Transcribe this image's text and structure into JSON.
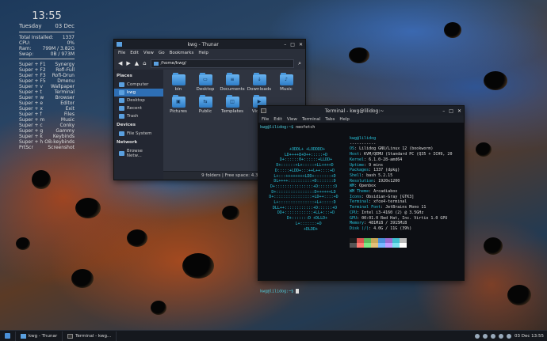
{
  "conky": {
    "time": "13:55",
    "day": "Tuesday",
    "date": "03 Dec",
    "stats": [
      [
        "Total Installed:",
        "1337"
      ],
      [
        "CPU:",
        "0%"
      ],
      [
        "Ram:",
        "799M / 3.82G"
      ],
      [
        "Swap:",
        "0B / 973M"
      ]
    ],
    "keys": [
      [
        "Super + F1",
        "Synergy"
      ],
      [
        "Super + F2",
        "Rofi-Full"
      ],
      [
        "Super + F3",
        "Rofi-Drun"
      ],
      [
        "Super + F5",
        "Dmenu"
      ],
      [
        "Super + v",
        "Wallpaper"
      ],
      [
        "Super + t",
        "Terminal"
      ],
      [
        "Super + w",
        "Browser"
      ],
      [
        "Super + e",
        "Editor"
      ],
      [
        "Super + x",
        "Exit"
      ],
      [
        "Super + f",
        "Files"
      ],
      [
        "Super + m",
        "Music"
      ],
      [
        "Super + c",
        "Conky"
      ],
      [
        "Super + g",
        "Gammy"
      ],
      [
        "Super + k",
        "Keybinds"
      ],
      [
        "Super + h",
        "OB-keybinds"
      ],
      [
        "PrtScr",
        "Screenshot"
      ]
    ]
  },
  "thunar": {
    "title": "kwg - Thunar",
    "menu": [
      "File",
      "Edit",
      "View",
      "Go",
      "Bookmarks",
      "Help"
    ],
    "path": "/home/kwg/",
    "places_head": "Places",
    "places": [
      "Computer",
      "kwg",
      "Desktop",
      "Recent",
      "Trash"
    ],
    "devices_head": "Devices",
    "devices": [
      "File System"
    ],
    "network_head": "Network",
    "network": [
      "Browse Netw..."
    ],
    "files": [
      "bin",
      "Desktop",
      "Documents",
      "Downloads",
      "Music",
      "Pictures",
      "Public",
      "Templates",
      "Videos"
    ],
    "status": "9 folders  |  Free space: 4.3 GiB"
  },
  "terminal": {
    "title": "Terminal - kwg@lilidog:~",
    "menu": [
      "File",
      "Edit",
      "View",
      "Terminal",
      "Tabs",
      "Help"
    ],
    "prompt": "kwg@lilidog:~$ ",
    "command": "neofetch",
    "userhost": "kwg@lilidog",
    "sep": "-----------",
    "info": [
      [
        "OS",
        "Lilidog GNU/Linux 12 (bookworm)"
      ],
      [
        "Host",
        "KVM/QEMU (Standard PC (Q35 + ICH9, 20"
      ],
      [
        "Kernel",
        "6.1.0-28-amd64"
      ],
      [
        "Uptime",
        "9 mins"
      ],
      [
        "Packages",
        "1337 (dpkg)"
      ],
      [
        "Shell",
        "bash 5.2.15"
      ],
      [
        "Resolution",
        "1920x1200"
      ],
      [
        "WM",
        "Openbox"
      ],
      [
        "WM Theme",
        "Arcadiabox"
      ],
      [
        "Icons",
        "Obsidian-Gray [GTK3]"
      ],
      [
        "Terminal",
        "xfce4-terminal"
      ],
      [
        "Terminal Font",
        "JetBrains Mono 11"
      ],
      [
        "CPU",
        "Intel i3-4160 (2) @ 3.5GHz"
      ],
      [
        "GPU",
        "00:01.0 Red Hat, Inc. Virtio 1.0 GPU"
      ],
      [
        "Memory",
        "481MiB / 3915MiB"
      ],
      [
        "Disk (/)",
        "4.0G / 11G (39%)"
      ]
    ],
    "palette1": [
      "#1c1c1c",
      "#d9534f",
      "#5cb85c",
      "#c8a85a",
      "#4a90d9",
      "#9b6bd0",
      "#3fc0d0",
      "#bbbbbb"
    ],
    "palette2": [
      "#555555",
      "#ff7b72",
      "#7ee787",
      "#e3c07a",
      "#79b8ff",
      "#c39bff",
      "#7ae0ee",
      "#ffffff"
    ],
    "logo": "   +ODDL+ +LODDDD+\n  LD++++8+D++:::::+D\n  D+::::::0+::::::+LLDD+\n D+::::::+L+:::::+LL++++D\n D:::::+LDD+:::++L++::::+D\n L+:::++++++++LDD+:::::::+D\n DL++++::::::::::+D:::::::D\nD+::::::::::::::::+D:::::::D\nD+::::::::::::::::D++++++LD\nD+::::::::::::::::+LD++::::+D\n L+:::::::::::::::+L+:::::D\n DLL++::::::::::::+D::::::+D\n  DD+::::::::::::+LL+:::+D\n   D+:::::::D +DLLD+\n    L+:::::::+D\n      +DLDD+"
  },
  "taskbar": {
    "items": [
      "kwg - Thunar",
      "Terminal - kwg..."
    ],
    "clock": "03 Dec 13:55"
  }
}
